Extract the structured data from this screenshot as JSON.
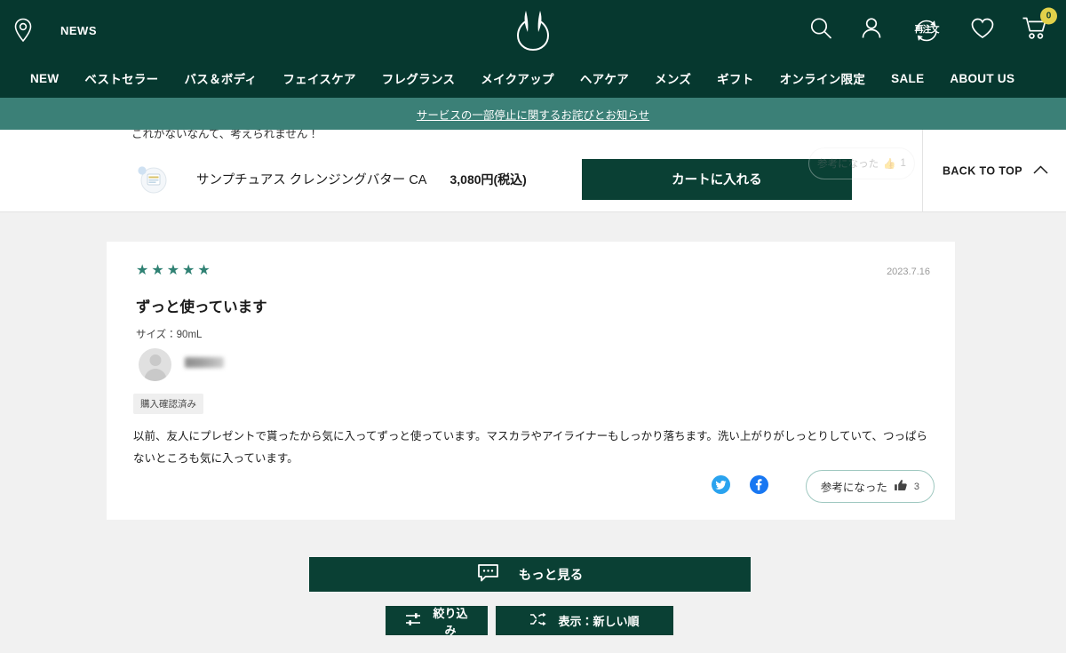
{
  "colors": {
    "header_green": "#06382f",
    "notice_teal": "#3b8077",
    "button_green": "#0a4034",
    "star_teal": "#2f8173",
    "badge_yellow": "#e2d14a",
    "page_bg": "#f1f1f1"
  },
  "header": {
    "news_label": "NEWS",
    "location_icon": "location-pin-icon",
    "logo_icon": "brand-logo-icon",
    "icons": [
      {
        "name": "search-icon",
        "label": ""
      },
      {
        "name": "account-icon",
        "label": ""
      },
      {
        "name": "reorder-icon",
        "label": "再注文"
      },
      {
        "name": "wishlist-heart-icon",
        "label": ""
      },
      {
        "name": "cart-icon",
        "label": ""
      }
    ],
    "cart_count": "0",
    "nav": [
      {
        "label": "NEW"
      },
      {
        "label": "ベストセラー"
      },
      {
        "label": "バス＆ボディ"
      },
      {
        "label": "フェイスケア"
      },
      {
        "label": "フレグランス"
      },
      {
        "label": "メイクアップ"
      },
      {
        "label": "ヘアケア"
      },
      {
        "label": "メンズ"
      },
      {
        "label": "ギフト"
      },
      {
        "label": "オンライン限定"
      },
      {
        "label": "SALE"
      },
      {
        "label": "ABOUT US"
      }
    ]
  },
  "notice": {
    "text": "サービスの一部停止に関するお詫びとお知らせ"
  },
  "sticky_bar": {
    "clipped_text": "これがないなんて、考えられません！",
    "product_name": "サンプチュアス クレンジングバター CA",
    "product_price": "3,080円(税込)",
    "add_to_cart_label": "カートに入れる",
    "ghost_helpful_label": "参考になった",
    "ghost_helpful_count": "1",
    "back_to_top_label": "BACK TO TOP"
  },
  "review": {
    "rating_stars": "★★★★★",
    "rating_value": 5,
    "date": "2023.7.16",
    "title": "ずっと使っています",
    "size_label": "サイズ：90mL",
    "username_masked": "",
    "verified_badge": "購入確認済み",
    "body": "以前、友人にプレゼントで貰ったから気に入ってずっと使っています。マスカラやアイライナーもしっかり落ちます。洗い上がりがしっとりしていて、つっぱらないところも気に入っています。",
    "share": [
      {
        "name": "twitter-share-icon"
      },
      {
        "name": "facebook-share-icon"
      }
    ],
    "helpful_label": "参考になった",
    "helpful_count": "3"
  },
  "footer_actions": {
    "more_label": "もっと見る",
    "more_icon": "comment-bubble-icon",
    "filter_label": "絞り込み",
    "filter_icon": "sliders-icon",
    "sort_label": "表示：新しい順",
    "sort_icon": "shuffle-icon"
  }
}
